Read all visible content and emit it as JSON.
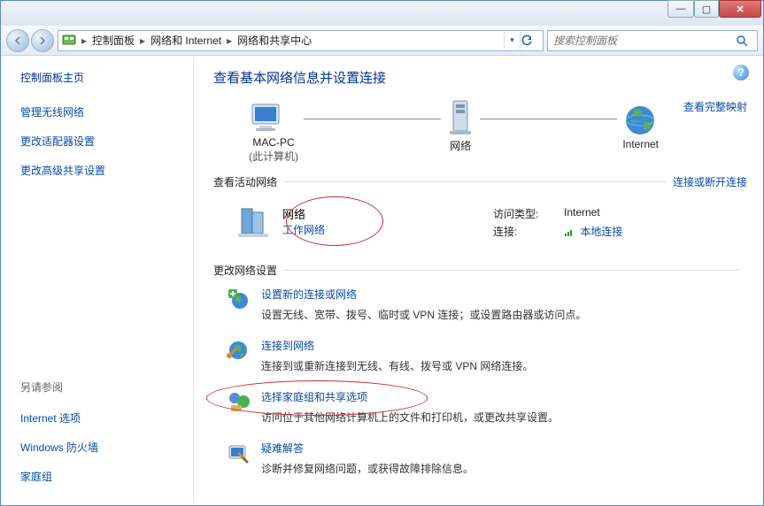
{
  "window": {
    "minimize": "—",
    "maximize": "▢",
    "close": "✕"
  },
  "breadcrumb": {
    "root_icon": "control-panel-icon",
    "items": [
      "控制面板",
      "网络和 Internet",
      "网络和共享中心"
    ]
  },
  "search": {
    "placeholder": "搜索控制面板"
  },
  "sidebar": {
    "home": "控制面板主页",
    "links": [
      "管理无线网络",
      "更改适配器设置",
      "更改高级共享设置"
    ],
    "see_also_title": "另请参阅",
    "see_also": [
      "Internet 选项",
      "Windows 防火墙",
      "家庭组"
    ]
  },
  "main": {
    "title": "查看基本网络信息并设置连接",
    "map_full_link": "查看完整映射",
    "nodes": {
      "pc_name": "MAC-PC",
      "pc_sub": "(此计算机)",
      "network": "网络",
      "internet": "Internet"
    },
    "active_section": "查看活动网络",
    "active_section_link": "连接或断开连接",
    "active_net": {
      "name": "网络",
      "type_link": "工作网络",
      "access_label": "访问类型:",
      "access_value": "Internet",
      "conn_label": "连接:",
      "conn_value": "本地连接"
    },
    "change_section": "更改网络设置",
    "settings": [
      {
        "icon": "plus-globe",
        "title": "设置新的连接或网络",
        "desc": "设置无线、宽带、拨号、临时或 VPN 连接；或设置路由器或访问点。"
      },
      {
        "icon": "link-globe",
        "title": "连接到网络",
        "desc": "连接到或重新连接到无线、有线、拨号或 VPN 网络连接。"
      },
      {
        "icon": "homegroup",
        "title": "选择家庭组和共享选项",
        "desc": "访问位于其他网络计算机上的文件和打印机，或更改共享设置。",
        "highlight": true
      },
      {
        "icon": "troubleshoot",
        "title": "疑难解答",
        "desc": "诊断并修复网络问题，或获得故障排除信息。"
      }
    ]
  }
}
